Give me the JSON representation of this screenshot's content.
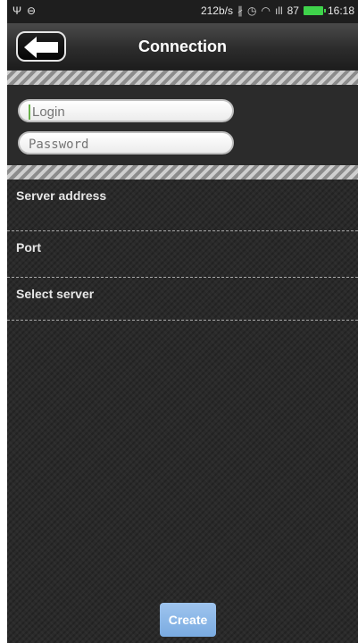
{
  "status_bar": {
    "left_icons": [
      "usb-icon",
      "sync-icon"
    ],
    "network_speed": "212b/s",
    "right_icons": [
      "bluetooth-icon",
      "alarm-icon",
      "wifi-icon",
      "signal-icon"
    ],
    "battery_level": "87",
    "time": "16:18"
  },
  "header": {
    "back_icon": "back-arrow-icon",
    "title": "Connection"
  },
  "login_form": {
    "login": {
      "value": "",
      "placeholder": "Login"
    },
    "password": {
      "value": "",
      "placeholder": "Password"
    }
  },
  "settings": {
    "items": [
      {
        "label": "Server address"
      },
      {
        "label": "Port"
      },
      {
        "label": "Select server"
      }
    ]
  },
  "footer": {
    "create_label": "Create"
  },
  "colors": {
    "create_button": "#8fb8e8",
    "battery": "#3fd34b",
    "background": "#2a2a2a"
  }
}
